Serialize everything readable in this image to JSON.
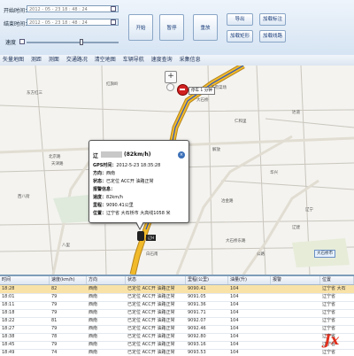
{
  "controls": {
    "start_time_label": "开始时间：",
    "start_time_value": "2012 - 05 - 23  18 : 48 : 24",
    "end_time_label": "结束时间：",
    "end_time_value": "2012 - 05 - 23  18 : 48 : 24",
    "speed_label": "速度",
    "start_btn": "开始",
    "pause_btn": "暂停",
    "stop_btn": "重放",
    "export_btn": "导出",
    "add_marker_btn": "加载标注",
    "add_rect_btn": "加载矩形",
    "add_line_btn": "加载线路"
  },
  "menu": [
    "矢量地图",
    "测距",
    "测面",
    "交通路况",
    "清空地图",
    "车辆导航",
    "速度查询",
    "采集信息"
  ],
  "map": {
    "places": [
      {
        "name": "天府菜场"
      },
      {
        "name": "大石桥"
      },
      {
        "name": "红旗岭"
      },
      {
        "name": "东方红三"
      },
      {
        "name": "仁和里"
      },
      {
        "name": "达道"
      },
      {
        "name": "北京路"
      },
      {
        "name": "天津路"
      },
      {
        "name": "解放"
      },
      {
        "name": "华兴"
      },
      {
        "name": "辽宁"
      },
      {
        "name": "西八街"
      },
      {
        "name": "冶金路"
      },
      {
        "name": "辽建"
      },
      {
        "name": "公路"
      },
      {
        "name": "八里"
      },
      {
        "name": "白石南"
      },
      {
        "name": "大石桥东路"
      }
    ],
    "stop_label": "停车 1 分钟",
    "car_label": "辽H",
    "station_label": "大石桥市"
  },
  "popup": {
    "title_prefix": "辽",
    "title_suffix": "(82km/h)",
    "gps_time_label": "GPS时间：",
    "gps_time": "2012-5-23 18:35:28",
    "direction_label": "方向：",
    "direction": "西南",
    "status_label": "状态：",
    "status": "已定位  ACC开  油路正常",
    "alarm_label": "报警信息：",
    "speed_label": "速度：",
    "speed": "82km/h",
    "mileage_label": "里程：",
    "mileage": "9090.41公里",
    "position_label": "位置：",
    "position": "辽宁省 大石桥市 大高线1058 米"
  },
  "table": {
    "headers": [
      "时间",
      "速度(km/h)",
      "方向",
      "状态",
      "里程(公里)",
      "油量(升)",
      "报警",
      "位置"
    ],
    "rows": [
      {
        "time": "18:28",
        "speed": "82",
        "dir": "西南",
        "status": "已定位 ACC开 油路正常",
        "mileage": "9090.41",
        "oil": "104",
        "alarm": "",
        "pos": "辽宁省 大石"
      },
      {
        "time": "18:01",
        "speed": "79",
        "dir": "西南",
        "status": "已定位 ACC开 油路正常",
        "mileage": "9091.05",
        "oil": "104",
        "alarm": "",
        "pos": "辽宁省"
      },
      {
        "time": "18:11",
        "speed": "79",
        "dir": "西南",
        "status": "已定位 ACC开 油路正常",
        "mileage": "9091.36",
        "oil": "104",
        "alarm": "",
        "pos": "辽宁省"
      },
      {
        "time": "18:18",
        "speed": "79",
        "dir": "西南",
        "status": "已定位 ACC开 油路正常",
        "mileage": "9091.71",
        "oil": "104",
        "alarm": "",
        "pos": "辽宁省"
      },
      {
        "time": "18:22",
        "speed": "81",
        "dir": "西南",
        "status": "已定位 ACC开 油路正常",
        "mileage": "9092.07",
        "oil": "104",
        "alarm": "",
        "pos": "辽宁省"
      },
      {
        "time": "18:27",
        "speed": "79",
        "dir": "西南",
        "status": "已定位 ACC开 油路正常",
        "mileage": "9092.46",
        "oil": "104",
        "alarm": "",
        "pos": "辽宁省"
      },
      {
        "time": "18:38",
        "speed": "78",
        "dir": "西南",
        "status": "已定位 ACC开 油路正常",
        "mileage": "9092.80",
        "oil": "104",
        "alarm": "",
        "pos": "辽宁省"
      },
      {
        "time": "18:45",
        "speed": "79",
        "dir": "西南",
        "status": "已定位 ACC开 油路正常",
        "mileage": "9093.16",
        "oil": "104",
        "alarm": "",
        "pos": "辽宁省"
      },
      {
        "time": "18:49",
        "speed": "74",
        "dir": "西南",
        "status": "已定位 ACC开 油路正常",
        "mileage": "9093.53",
        "oil": "104",
        "alarm": "",
        "pos": "辽宁省"
      }
    ]
  },
  "watermark": "Jx",
  "colors": {
    "route": "#f1ba2a",
    "selected_row": "#f9e2a8",
    "stop_marker": "#d12020"
  }
}
